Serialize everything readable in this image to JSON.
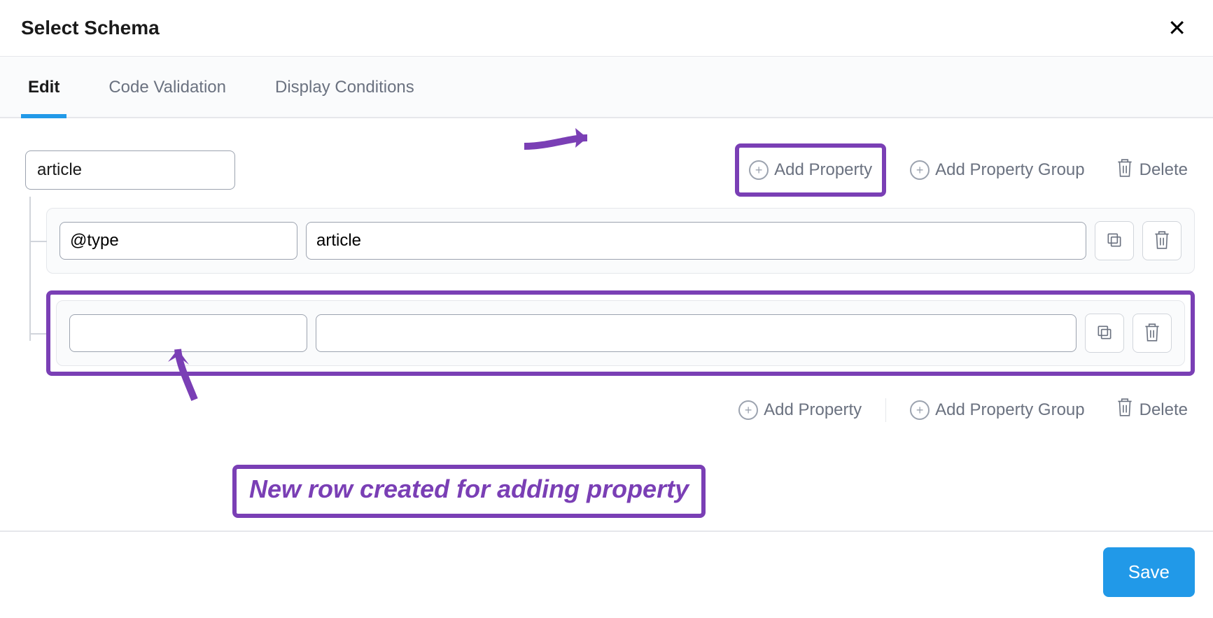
{
  "header": {
    "title": "Select Schema"
  },
  "tabs": {
    "edit": "Edit",
    "code_validation": "Code Validation",
    "display_conditions": "Display Conditions"
  },
  "schema": {
    "root_value": "article",
    "rows": [
      {
        "key": "@type",
        "value": "article"
      },
      {
        "key": "",
        "value": ""
      }
    ]
  },
  "actions": {
    "add_property": "Add Property",
    "add_property_group": "Add Property Group",
    "delete": "Delete"
  },
  "footer": {
    "save": "Save"
  },
  "annotation": {
    "new_row": "New row created for adding property"
  },
  "colors": {
    "accent_purple": "#7a3fb5",
    "primary_blue": "#2199e8"
  }
}
